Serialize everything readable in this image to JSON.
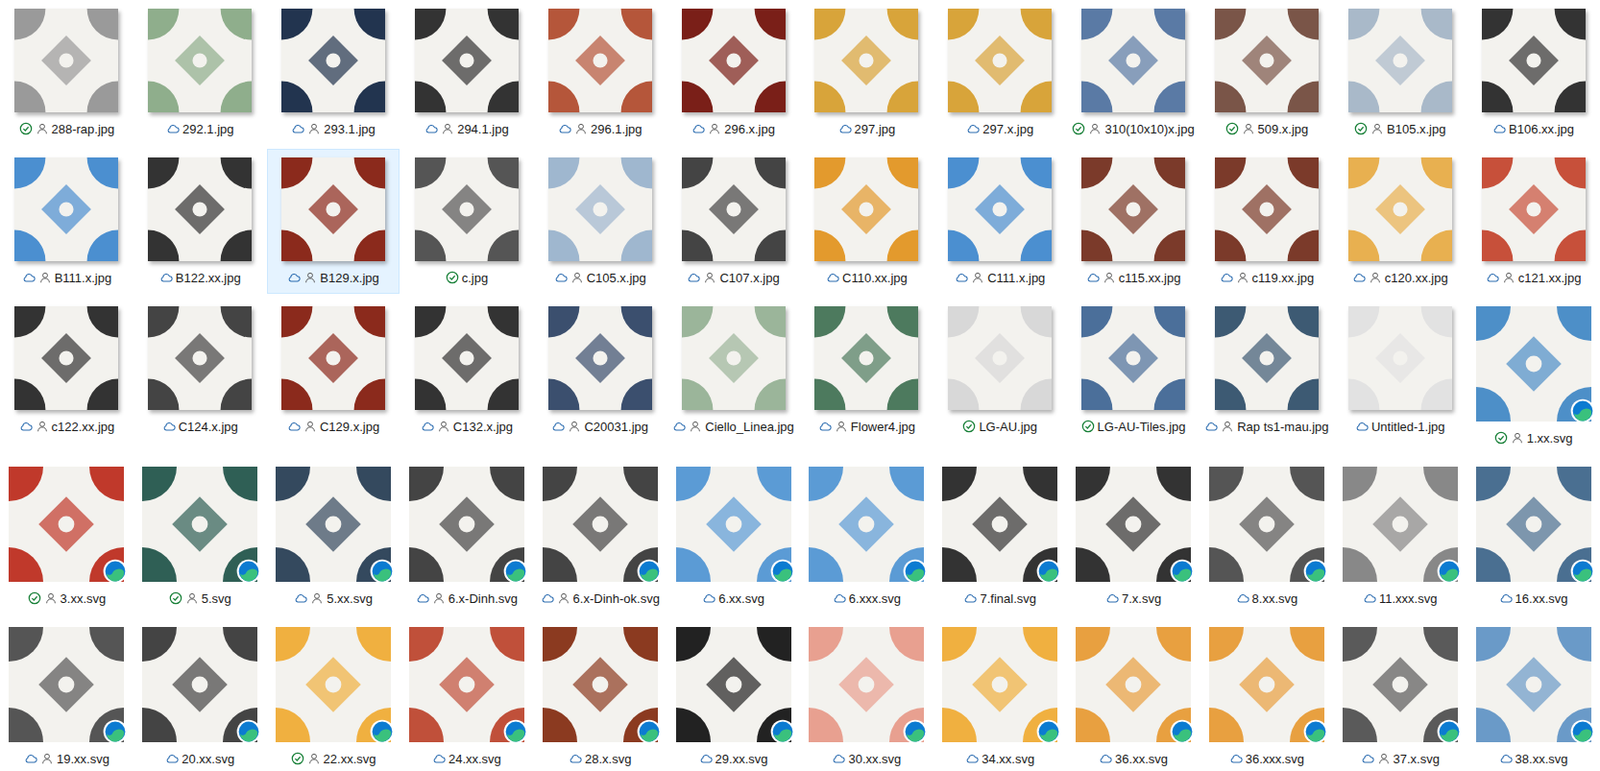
{
  "files": [
    {
      "name": "288-rap.jpg",
      "kind": "synced",
      "shared": true,
      "badge": false,
      "selected": false,
      "color": "#9a9a9a"
    },
    {
      "name": "292.1.jpg",
      "kind": "cloud",
      "shared": false,
      "badge": false,
      "selected": false,
      "color": "#8fae8c"
    },
    {
      "name": "293.1.jpg",
      "kind": "cloud",
      "shared": true,
      "badge": false,
      "selected": false,
      "color": "#22344f"
    },
    {
      "name": "294.1.jpg",
      "kind": "cloud",
      "shared": true,
      "badge": false,
      "selected": false,
      "color": "#333333"
    },
    {
      "name": "296.1.jpg",
      "kind": "cloud",
      "shared": true,
      "badge": false,
      "selected": false,
      "color": "#b5563a"
    },
    {
      "name": "296.x.jpg",
      "kind": "cloud",
      "shared": true,
      "badge": false,
      "selected": false,
      "color": "#7a1f18"
    },
    {
      "name": "297.jpg",
      "kind": "cloud",
      "shared": false,
      "badge": false,
      "selected": false,
      "color": "#d8a43a"
    },
    {
      "name": "297.x.jpg",
      "kind": "cloud",
      "shared": false,
      "badge": false,
      "selected": false,
      "color": "#d8a43a"
    },
    {
      "name": "310(10x10)x.jpg",
      "kind": "synced",
      "shared": true,
      "badge": false,
      "selected": false,
      "color": "#5a7aa5"
    },
    {
      "name": "509.x.jpg",
      "kind": "synced",
      "shared": true,
      "badge": false,
      "selected": false,
      "color": "#7a5548"
    },
    {
      "name": "B105.x.jpg",
      "kind": "synced",
      "shared": true,
      "badge": false,
      "selected": false,
      "color": "#a9b9c9"
    },
    {
      "name": "B106.xx.jpg",
      "kind": "cloud",
      "shared": false,
      "badge": false,
      "selected": false,
      "color": "#333333"
    },
    {
      "name": "B111.x.jpg",
      "kind": "cloud",
      "shared": true,
      "badge": false,
      "selected": false,
      "color": "#4b8fd0"
    },
    {
      "name": "B122.xx.jpg",
      "kind": "cloud",
      "shared": false,
      "badge": false,
      "selected": false,
      "color": "#333333"
    },
    {
      "name": "B129.x.jpg",
      "kind": "cloud",
      "shared": true,
      "badge": false,
      "selected": true,
      "color": "#8b2a1c"
    },
    {
      "name": "c.jpg",
      "kind": "synced",
      "shared": false,
      "badge": false,
      "selected": false,
      "color": "#555555"
    },
    {
      "name": "C105.x.jpg",
      "kind": "cloud",
      "shared": true,
      "badge": false,
      "selected": false,
      "color": "#9fb7cf"
    },
    {
      "name": "C107.x.jpg",
      "kind": "cloud",
      "shared": true,
      "badge": false,
      "selected": false,
      "color": "#444444"
    },
    {
      "name": "C110.xx.jpg",
      "kind": "cloud",
      "shared": false,
      "badge": false,
      "selected": false,
      "color": "#e39a2d"
    },
    {
      "name": "C111.x.jpg",
      "kind": "cloud",
      "shared": true,
      "badge": false,
      "selected": false,
      "color": "#4b8fd0"
    },
    {
      "name": "c115.xx.jpg",
      "kind": "cloud",
      "shared": true,
      "badge": false,
      "selected": false,
      "color": "#7b3a2a"
    },
    {
      "name": "c119.xx.jpg",
      "kind": "cloud",
      "shared": true,
      "badge": false,
      "selected": false,
      "color": "#7b3a2a"
    },
    {
      "name": "c120.xx.jpg",
      "kind": "cloud",
      "shared": true,
      "badge": false,
      "selected": false,
      "color": "#e8b050"
    },
    {
      "name": "c121.xx.jpg",
      "kind": "cloud",
      "shared": true,
      "badge": false,
      "selected": false,
      "color": "#c7503a"
    },
    {
      "name": "c122.xx.jpg",
      "kind": "cloud",
      "shared": true,
      "badge": false,
      "selected": false,
      "color": "#333333"
    },
    {
      "name": "C124.x.jpg",
      "kind": "cloud",
      "shared": false,
      "badge": false,
      "selected": false,
      "color": "#444444"
    },
    {
      "name": "C129.x.jpg",
      "kind": "cloud",
      "shared": true,
      "badge": false,
      "selected": false,
      "color": "#8b2a1c"
    },
    {
      "name": "C132.x.jpg",
      "kind": "cloud",
      "shared": true,
      "badge": false,
      "selected": false,
      "color": "#333333"
    },
    {
      "name": "C20031.jpg",
      "kind": "cloud",
      "shared": true,
      "badge": false,
      "selected": false,
      "color": "#3b4f6e"
    },
    {
      "name": "Ciello_Linea.jpg",
      "kind": "cloud",
      "shared": true,
      "badge": false,
      "selected": false,
      "color": "#9bb59a"
    },
    {
      "name": "Flower4.jpg",
      "kind": "cloud",
      "shared": true,
      "badge": false,
      "selected": false,
      "color": "#4d7a5e"
    },
    {
      "name": "LG-AU.jpg",
      "kind": "synced",
      "shared": false,
      "badge": false,
      "selected": false,
      "color": "#d8d8d8"
    },
    {
      "name": "LG-AU-Tiles.jpg",
      "kind": "synced",
      "shared": false,
      "badge": false,
      "selected": false,
      "color": "#4b6f9a"
    },
    {
      "name": "Rap ts1-mau.jpg",
      "kind": "cloud",
      "shared": true,
      "badge": false,
      "selected": false,
      "color": "#3d5a73"
    },
    {
      "name": "Untitled-1.jpg",
      "kind": "cloud",
      "shared": false,
      "badge": false,
      "selected": false,
      "color": "#e2e2e2"
    },
    {
      "name": "1.xx.svg",
      "kind": "synced",
      "shared": true,
      "badge": true,
      "selected": false,
      "color": "#4d8fc8"
    },
    {
      "name": "3.xx.svg",
      "kind": "synced",
      "shared": true,
      "badge": true,
      "selected": false,
      "color": "#c0392b"
    },
    {
      "name": "5.svg",
      "kind": "synced",
      "shared": true,
      "badge": true,
      "selected": false,
      "color": "#2f5f55"
    },
    {
      "name": "5.xx.svg",
      "kind": "cloud",
      "shared": true,
      "badge": true,
      "selected": false,
      "color": "#34495e"
    },
    {
      "name": "6.x-Dinh.svg",
      "kind": "cloud",
      "shared": true,
      "badge": true,
      "selected": false,
      "color": "#444444"
    },
    {
      "name": "6.x-Dinh-ok.svg",
      "kind": "cloud",
      "shared": true,
      "badge": true,
      "selected": false,
      "color": "#444444"
    },
    {
      "name": "6.xx.svg",
      "kind": "cloud",
      "shared": false,
      "badge": true,
      "selected": false,
      "color": "#5b9bd5"
    },
    {
      "name": "6.xxx.svg",
      "kind": "cloud",
      "shared": false,
      "badge": true,
      "selected": false,
      "color": "#5b9bd5"
    },
    {
      "name": "7.final.svg",
      "kind": "cloud",
      "shared": false,
      "badge": true,
      "selected": false,
      "color": "#333333"
    },
    {
      "name": "7.x.svg",
      "kind": "cloud",
      "shared": false,
      "badge": true,
      "selected": false,
      "color": "#333333"
    },
    {
      "name": "8.xx.svg",
      "kind": "cloud",
      "shared": false,
      "badge": true,
      "selected": false,
      "color": "#555555"
    },
    {
      "name": "11.xxx.svg",
      "kind": "cloud",
      "shared": false,
      "badge": true,
      "selected": false,
      "color": "#888888"
    },
    {
      "name": "16.xx.svg",
      "kind": "cloud",
      "shared": false,
      "badge": true,
      "selected": false,
      "color": "#4a6f91"
    },
    {
      "name": "19.xx.svg",
      "kind": "cloud",
      "shared": true,
      "badge": true,
      "selected": false,
      "color": "#555555"
    },
    {
      "name": "20.xx.svg",
      "kind": "cloud",
      "shared": false,
      "badge": true,
      "selected": false,
      "color": "#444444"
    },
    {
      "name": "22.xx.svg",
      "kind": "synced",
      "shared": true,
      "badge": true,
      "selected": false,
      "color": "#f0b040"
    },
    {
      "name": "24.xx.svg",
      "kind": "cloud",
      "shared": false,
      "badge": true,
      "selected": false,
      "color": "#c0503a"
    },
    {
      "name": "28.x.svg",
      "kind": "cloud",
      "shared": false,
      "badge": true,
      "selected": false,
      "color": "#8b3a20"
    },
    {
      "name": "29.xx.svg",
      "kind": "cloud",
      "shared": false,
      "badge": true,
      "selected": false,
      "color": "#222222"
    },
    {
      "name": "30.xx.svg",
      "kind": "cloud",
      "shared": false,
      "badge": true,
      "selected": false,
      "color": "#e8a090"
    },
    {
      "name": "34.xx.svg",
      "kind": "cloud",
      "shared": false,
      "badge": true,
      "selected": false,
      "color": "#f0b040"
    },
    {
      "name": "36.xx.svg",
      "kind": "cloud",
      "shared": false,
      "badge": true,
      "selected": false,
      "color": "#e8a040"
    },
    {
      "name": "36.xxx.svg",
      "kind": "cloud",
      "shared": false,
      "badge": true,
      "selected": false,
      "color": "#e8a040"
    },
    {
      "name": "37.x.svg",
      "kind": "cloud",
      "shared": true,
      "badge": true,
      "selected": false,
      "color": "#5a5a5a"
    },
    {
      "name": "38.xx.svg",
      "kind": "cloud",
      "shared": false,
      "badge": true,
      "selected": false,
      "color": "#6a9ac8"
    }
  ]
}
